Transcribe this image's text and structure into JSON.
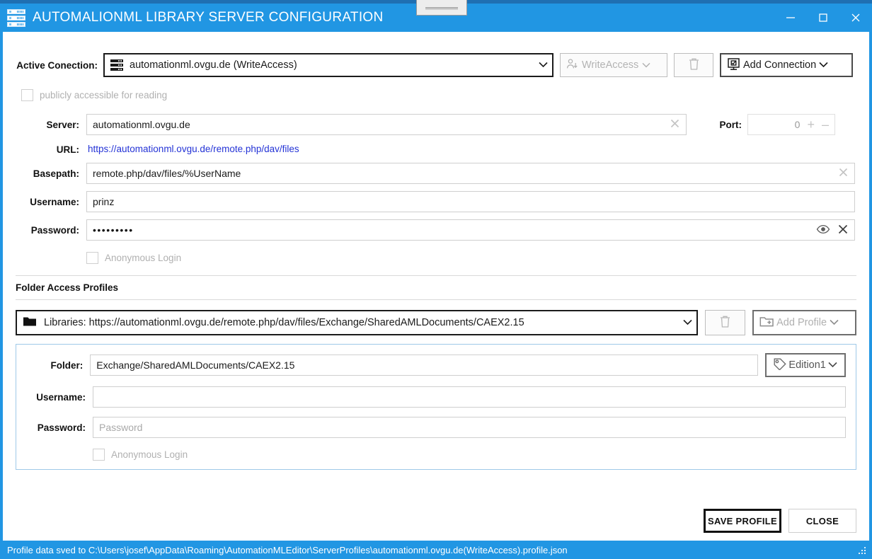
{
  "window": {
    "title": "AUTOMALIONML LIBRARY SERVER CONFIGURATION",
    "app_icon": "server-rack-icon",
    "minimize_label": "–",
    "maximize_label": "□",
    "close_label": "✕",
    "accent_color": "#2196e3"
  },
  "connection": {
    "label": "Active Conection:",
    "icon": "server-rack-icon",
    "value": "automationml.ovgu.de (WriteAccess)",
    "access_dropdown": {
      "icon": "user-download-icon",
      "value": "WriteAccess"
    },
    "delete_button": {
      "icon": "trash-icon",
      "label": ""
    },
    "add_button": {
      "icon": "add-connection-icon",
      "label": "Add Connection"
    }
  },
  "public_checkbox": {
    "label": "publicly accessible for reading",
    "checked": false
  },
  "server": {
    "label": "Server:",
    "value": "automationml.ovgu.de",
    "clear_icon": "clear-x-icon"
  },
  "port": {
    "label": "Port:",
    "value": "0",
    "increment": "+",
    "decrement": "–"
  },
  "url": {
    "label": "URL:",
    "value": "https://automationml.ovgu.de/remote.php/dav/files"
  },
  "basepath": {
    "label": "Basepath:",
    "value": "remote.php/dav/files/%UserName",
    "clear_icon": "clear-x-icon"
  },
  "username": {
    "label": "Username:",
    "value": "prinz"
  },
  "password": {
    "label": "Password:",
    "value": "•••••••••",
    "reveal_icon": "eye-icon",
    "clear_icon": "clear-x-icon"
  },
  "anonymous_login": {
    "label": "Anonymous Login",
    "checked": false
  },
  "folder_profiles": {
    "section_label": "Folder Access Profiles",
    "selected": "Libraries: https://automationml.ovgu.de/remote.php/dav/files/Exchange/SharedAMLDocuments/CAEX2.15",
    "folder_icon": "folder-icon",
    "delete_button": {
      "icon": "trash-icon"
    },
    "add_button": {
      "icon": "add-folder-icon",
      "label": "Add Profile"
    },
    "folder": {
      "label": "Folder:",
      "value": "Exchange/SharedAMLDocuments/CAEX2.15",
      "edition": {
        "icon": "tag-icon",
        "value": "Edition1"
      }
    },
    "username": {
      "label": "Username:",
      "value": ""
    },
    "password": {
      "label": "Password:",
      "value": "",
      "placeholder": "Password"
    },
    "anonymous_login": {
      "label": "Anonymous Login",
      "checked": false
    }
  },
  "footer": {
    "save_label": "SAVE PROFILE",
    "close_label": "CLOSE"
  },
  "statusbar": {
    "message": "Profile data sved to C:\\Users\\josef\\AppData\\Roaming\\AutomationMLEditor\\ServerProfiles\\automationml.ovgu.de(WriteAccess).profile.json",
    "grip_icon": "resize-grip-icon"
  }
}
